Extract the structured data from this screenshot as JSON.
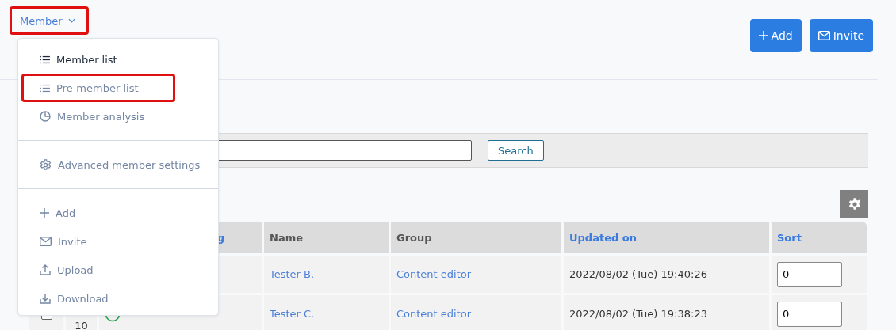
{
  "menu_trigger": {
    "label": "Member",
    "highlighted": true
  },
  "header_buttons": [
    {
      "kind": "plus",
      "label": "Add"
    },
    {
      "kind": "mail",
      "label": "Invite"
    }
  ],
  "menu": {
    "sections": [
      [
        {
          "kind": "list",
          "label": "Member list",
          "selected": true,
          "highlighted": false
        },
        {
          "kind": "list",
          "label": "Pre-member list",
          "selected": false,
          "highlighted": true
        },
        {
          "kind": "chart",
          "label": "Member analysis",
          "selected": false,
          "highlighted": false
        }
      ],
      [
        {
          "kind": "gear",
          "label": "Advanced member settings",
          "selected": false,
          "highlighted": false
        }
      ],
      [
        {
          "kind": "plus",
          "label": "Add",
          "selected": false,
          "highlighted": false
        },
        {
          "kind": "mail",
          "label": "Invite",
          "selected": false,
          "highlighted": false
        },
        {
          "kind": "upload",
          "label": "Upload",
          "selected": false,
          "highlighted": false
        },
        {
          "kind": "download",
          "label": "Download",
          "selected": false,
          "highlighted": false
        }
      ]
    ]
  },
  "search": {
    "button": "Search"
  },
  "table": {
    "columns": [
      {},
      {},
      {
        "label": "g",
        "sortable": true
      },
      {
        "label": "Name",
        "sortable": false
      },
      {
        "label": "Group",
        "sortable": false
      },
      {
        "label": "Updated on",
        "sortable": true
      },
      {
        "label": "Sort",
        "sortable": true
      }
    ],
    "rows": [
      {
        "name": "Tester B.",
        "group": "Content editor",
        "updated_on": "2022/08/02 (Tue) 19:40:26",
        "sort": "0"
      },
      {
        "checked": false,
        "number": "10",
        "name": "Tester C.",
        "group": "Content editor",
        "updated_on": "2022/08/02 (Tue) 19:38:23",
        "sort": "0"
      }
    ]
  }
}
